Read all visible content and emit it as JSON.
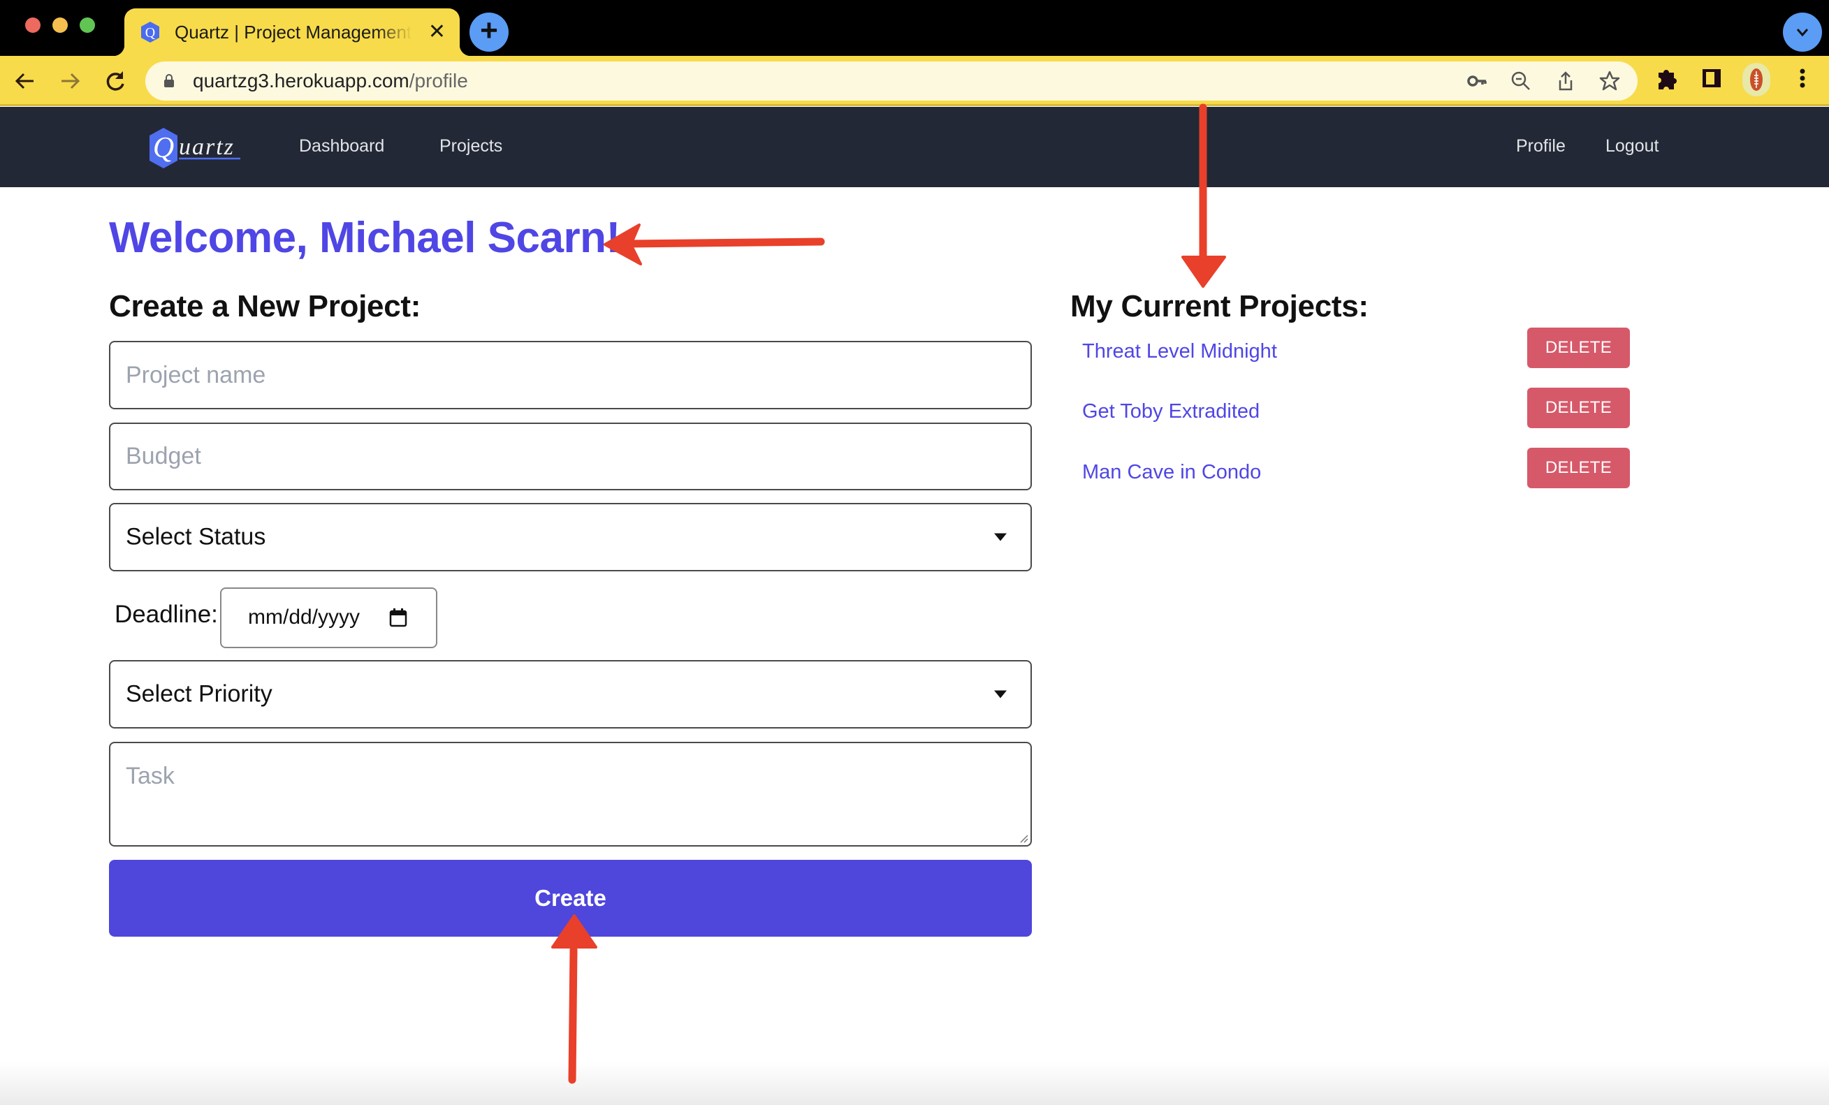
{
  "browser": {
    "tab_title": "Quartz | Project Management Tool",
    "tab_close": "✕",
    "new_tab": "+",
    "url_host": "quartzg3.herokuapp.com",
    "url_path": "/profile"
  },
  "navbar": {
    "brand": "Quartz",
    "links": [
      "Dashboard",
      "Projects"
    ],
    "right_links": [
      "Profile",
      "Logout"
    ]
  },
  "page": {
    "welcome": "Welcome, Michael Scarn!",
    "create_section": {
      "title": "Create a New Project:",
      "project_name_placeholder": "Project name",
      "budget_placeholder": "Budget",
      "status_select": "Select Status",
      "deadline_label": "Deadline:",
      "deadline_placeholder": "mm/dd/yyyy",
      "priority_select": "Select Priority",
      "task_placeholder": "Task",
      "submit_label": "Create"
    },
    "projects_section": {
      "title": "My Current Projects:",
      "projects": [
        {
          "name": "Threat Level Midnight",
          "action": "DELETE"
        },
        {
          "name": "Get Toby Extradited",
          "action": "DELETE"
        },
        {
          "name": "Man Cave in Condo",
          "action": "DELETE"
        }
      ]
    }
  },
  "colors": {
    "accent": "#4f46e5",
    "navbar_bg": "#222836",
    "delete": "#d6596a",
    "chrome_yellow": "#f8db4a",
    "annotation_red": "#e8402a"
  }
}
